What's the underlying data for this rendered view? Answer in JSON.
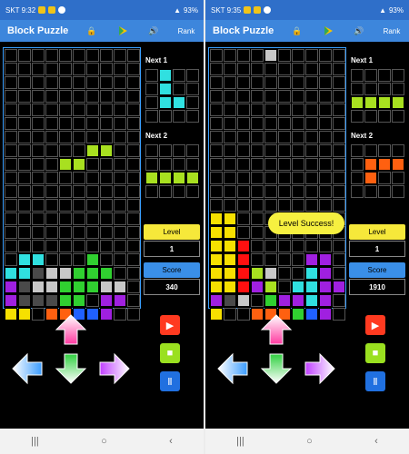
{
  "screens": [
    {
      "status": {
        "time": "SKT 9:32",
        "battery": "93%"
      },
      "appbar": {
        "title": "Block Puzzle",
        "rank_label": "Rank"
      },
      "next1_label": "Next 1",
      "next2_label": "Next 2",
      "level_label": "Level",
      "level_value": "1",
      "score_label": "Score",
      "score_value": "340"
    },
    {
      "status": {
        "time": "SKT 9:35",
        "battery": "93%"
      },
      "appbar": {
        "title": "Block Puzzle",
        "rank_label": "Rank"
      },
      "next1_label": "Next 1",
      "next2_label": "Next 2",
      "level_label": "Level",
      "level_value": "1",
      "score_label": "Score",
      "score_value": "1910",
      "toast": "Level Success!"
    }
  ],
  "colors": {
    "appbar": "#3d86dc",
    "statusbar": "#2f6fc9",
    "board_border": "#3aa0ff",
    "level_label_bg": "#f6e83a",
    "score_label_bg": "#3a8fe8",
    "cyan": "#30e0e0",
    "lime": "#a8e020",
    "orange": "#ff6010",
    "yellow": "#f6e000",
    "green": "#30d030",
    "gray": "#c8c8c8",
    "dark_gray": "#4a4a4a",
    "purple": "#a020e0",
    "red": "#ff1010",
    "blue": "#2060ff"
  },
  "icons": [
    "lock-icon",
    "play-store-icon",
    "speaker-icon",
    "up-arrow-icon",
    "left-arrow-icon",
    "down-arrow-icon",
    "right-arrow-icon",
    "play-icon",
    "stop-icon",
    "pause-icon"
  ]
}
